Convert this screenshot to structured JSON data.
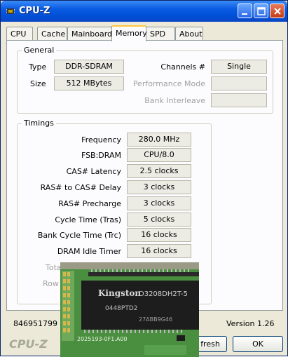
{
  "window": {
    "title": "CPU-Z"
  },
  "tabs": [
    {
      "label": "CPU"
    },
    {
      "label": "Cache"
    },
    {
      "label": "Mainboard"
    },
    {
      "label": "Memory"
    },
    {
      "label": "SPD"
    },
    {
      "label": "About"
    }
  ],
  "general": {
    "group_label": "General",
    "type_label": "Type",
    "type_value": "DDR-SDRAM",
    "size_label": "Size",
    "size_value": "512 MBytes",
    "channels_label": "Channels #",
    "channels_value": "Single",
    "perf_mode_label": "Performance Mode",
    "bank_interleave_label": "Bank Interleave"
  },
  "timings": {
    "group_label": "Timings",
    "rows": [
      {
        "label": "Frequency",
        "value": "280.0 MHz"
      },
      {
        "label": "FSB:DRAM",
        "value": "CPU/8.0"
      },
      {
        "label": "CAS# Latency",
        "value": "2.5 clocks"
      },
      {
        "label": "RAS# to CAS# Delay",
        "value": "3 clocks"
      },
      {
        "label": "RAS# Precharge",
        "value": "3 clocks"
      },
      {
        "label": "Cycle Time (Tras)",
        "value": "5 clocks"
      },
      {
        "label": "Bank Cycle Time (Trc)",
        "value": "16 clocks"
      },
      {
        "label": "DRAM Idle Timer",
        "value": "16 clocks"
      }
    ],
    "partial_label_1": "Tota",
    "partial_label_2": "Row"
  },
  "footer": {
    "id": "846951799",
    "version": "Version 1.26",
    "logo": "CPU-Z",
    "refresh_label": "fresh",
    "ok_label": "OK"
  },
  "photo": {
    "brand": "Kingston",
    "chip_code": "D3208DH2T-5",
    "chip_line2": "0448PTD2",
    "chip_line3": "27ABB9G46",
    "pcb_code": "2025193-0F1.A00"
  },
  "colors": {
    "titlebar": "#0a5ae2",
    "window_bg": "#ece9d8",
    "active_tab_accent": "#ffc83c",
    "pcb_green": "#3f8f3a"
  }
}
